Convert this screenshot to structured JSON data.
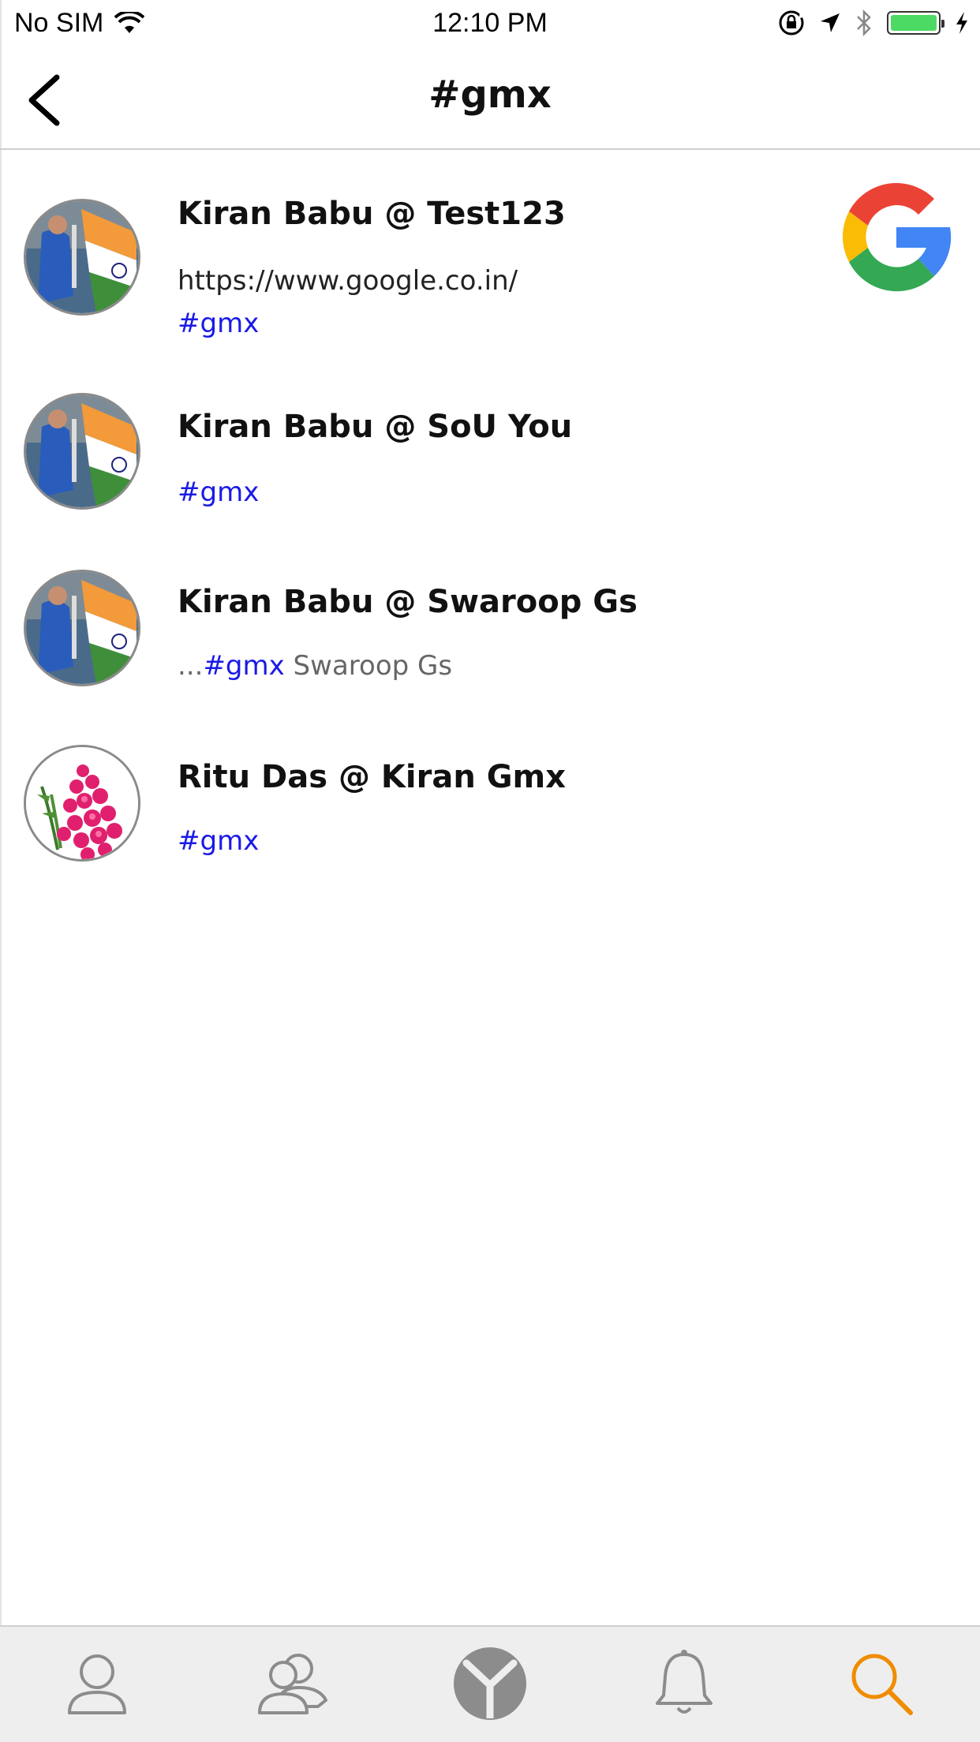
{
  "status_bar": {
    "carrier": "No SIM",
    "time": "12:10 PM",
    "battery_level": 1.0
  },
  "nav": {
    "title": "#gmx",
    "back_icon": "chevron-left-icon"
  },
  "feed": [
    {
      "title": "Kiran Babu @ Test123",
      "link": "https://www.google.co.in/",
      "hashtag": "#gmx",
      "avatar": "cricket-player-flag-photo",
      "thumbnail": "google-logo-icon"
    },
    {
      "title": "Kiran Babu @ SoU You",
      "hashtag": "#gmx",
      "avatar": "cricket-player-flag-photo"
    },
    {
      "title": "Kiran Babu @ Swaroop Gs",
      "prefix": "...",
      "hashtag": "#gmx",
      "suffix": " Swaroop Gs",
      "avatar": "cricket-player-flag-photo"
    },
    {
      "title": "Ritu Das @ Kiran Gmx",
      "hashtag": "#gmx",
      "avatar": "pink-roses-bouquet-photo"
    }
  ],
  "tab_bar": {
    "tabs": [
      {
        "icon": "profile-icon",
        "active": false
      },
      {
        "icon": "friends-icon",
        "active": false
      },
      {
        "icon": "app-logo-icon",
        "active": false
      },
      {
        "icon": "bell-icon",
        "active": false
      },
      {
        "icon": "search-icon",
        "active": true
      }
    ],
    "active_color": "#f08c00",
    "inactive_color": "#8c8c8c"
  },
  "colors": {
    "hashtag": "#1a1ae6",
    "battery": "#4cd964"
  }
}
